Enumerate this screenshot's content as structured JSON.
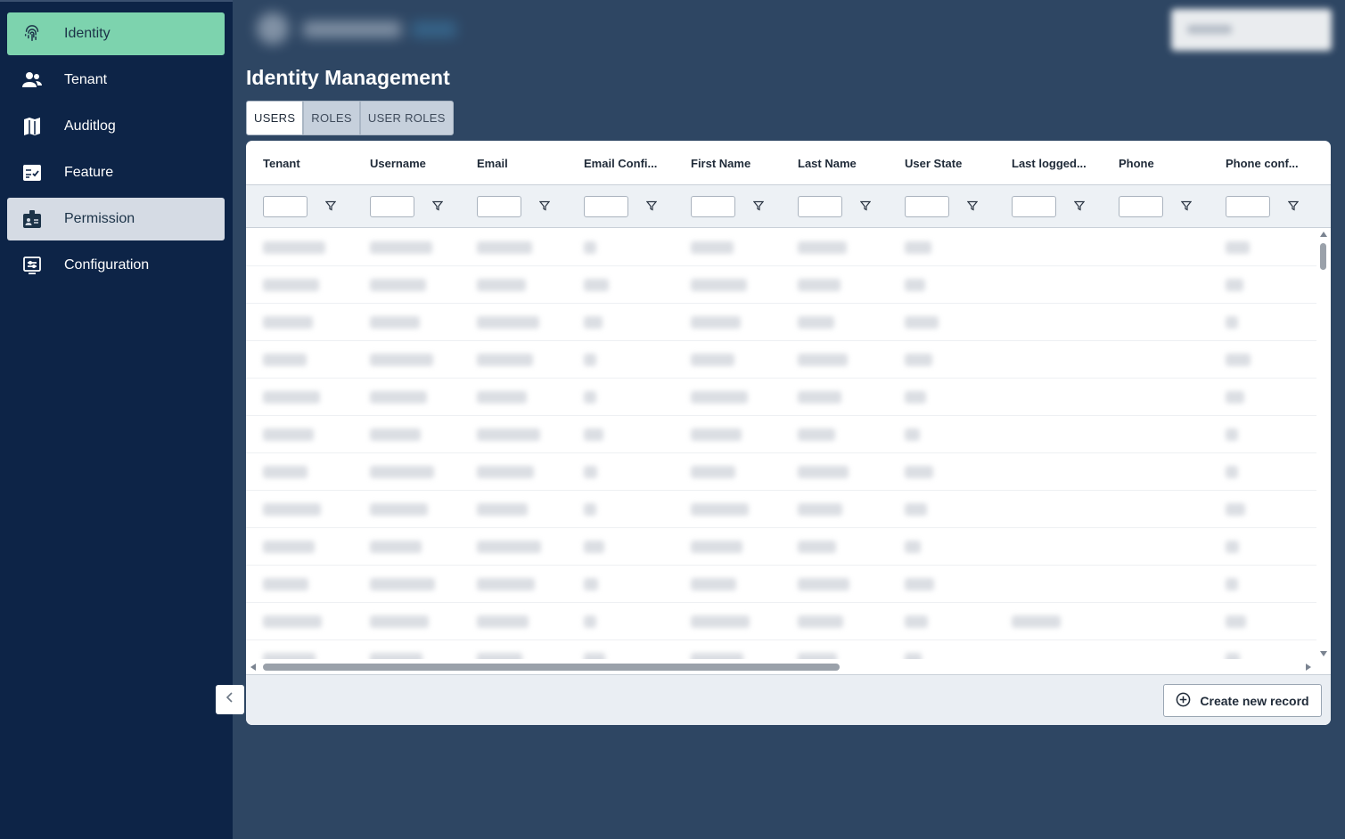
{
  "sidebar": {
    "items": [
      {
        "label": "Identity",
        "icon": "fingerprint-icon",
        "state": "active"
      },
      {
        "label": "Tenant",
        "icon": "users-icon",
        "state": ""
      },
      {
        "label": "Auditlog",
        "icon": "map-icon",
        "state": ""
      },
      {
        "label": "Feature",
        "icon": "checklist-icon",
        "state": ""
      },
      {
        "label": "Permission",
        "icon": "badge-icon",
        "state": "selected"
      },
      {
        "label": "Configuration",
        "icon": "settings-panel-icon",
        "state": ""
      }
    ]
  },
  "page": {
    "title": "Identity Management"
  },
  "tabs": [
    {
      "label": "USERS",
      "active": true
    },
    {
      "label": "ROLES",
      "active": false
    },
    {
      "label": "USER ROLES",
      "active": false
    }
  ],
  "grid": {
    "columns": [
      "Tenant",
      "Username",
      "Email",
      "Email Confi...",
      "First Name",
      "Last Name",
      "User State",
      "Last logged...",
      "Phone",
      "Phone conf..."
    ],
    "filter_icon": "funnel-icon"
  },
  "footer": {
    "create_label": "Create new record",
    "create_icon": "plus-circle-icon"
  },
  "colors": {
    "sidebar": "#0d2447",
    "background": "#2e4663",
    "accent": "#7dd3ae",
    "selected": "#d5dbe4"
  }
}
